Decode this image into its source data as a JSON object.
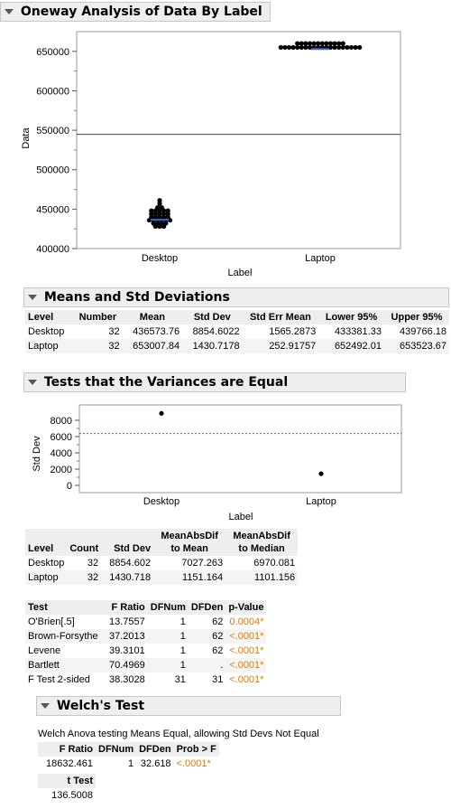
{
  "oneway": {
    "title": "Oneway Analysis of Data By Label",
    "ylabel": "Data",
    "xlabel": "Label",
    "yticks": [
      "650000",
      "600000",
      "550000",
      "500000",
      "450000",
      "400000"
    ],
    "categories": [
      "Desktop",
      "Laptop"
    ]
  },
  "chart_data": [
    {
      "type": "scatter",
      "title": "Oneway Analysis of Data By Label",
      "xlabel": "Label",
      "ylabel": "Data",
      "categories": [
        "Desktop",
        "Laptop"
      ],
      "ylim": [
        400000,
        675000
      ],
      "yticks": [
        400000,
        450000,
        500000,
        550000,
        600000,
        650000
      ],
      "grand_mean": 544790.8,
      "group_means": [
        436573.76,
        653007.84
      ],
      "desktop_points": [
        461000,
        457000,
        452000,
        452000,
        448000,
        448000,
        448000,
        448000,
        448000,
        444000,
        444000,
        444000,
        444000,
        444000,
        440000,
        440000,
        440000,
        440000,
        440000,
        436000,
        436000,
        436000,
        436000,
        436000,
        436000,
        432000,
        432000,
        432000,
        432000,
        428000,
        428000,
        428000
      ],
      "laptop_points": [
        660000,
        660000,
        660000,
        660000,
        660000,
        660000,
        660000,
        660000,
        660000,
        660000,
        660000,
        660000,
        655000,
        655000,
        655000,
        655000,
        655000,
        655000,
        655000,
        655000,
        655000,
        655000,
        655000,
        655000,
        655000,
        655000,
        655000,
        655000,
        655000,
        655000,
        655000,
        655000
      ]
    },
    {
      "type": "scatter",
      "title": "Tests that the Variances are Equal",
      "xlabel": "Label",
      "ylabel": "Std Dev",
      "categories": [
        "Desktop",
        "Laptop"
      ],
      "values": [
        8854.602,
        1430.718
      ],
      "ylim": [
        0,
        9000
      ],
      "yticks": [
        0,
        2000,
        4000,
        6000,
        8000
      ],
      "reference_line": 6380
    }
  ],
  "means": {
    "title": "Means and Std Deviations",
    "headers": [
      "Level",
      "Number",
      "Mean",
      "Std Dev",
      "Std Err Mean",
      "Lower 95%",
      "Upper 95%"
    ],
    "rows": [
      [
        "Desktop",
        "32",
        "436573.76",
        "8854.6022",
        "1565.2873",
        "433381.33",
        "439766.18"
      ],
      [
        "Laptop",
        "32",
        "653007.84",
        "1430.7178",
        "252.91757",
        "652492.01",
        "653523.67"
      ]
    ]
  },
  "variances": {
    "title": "Tests that the Variances are Equal",
    "ylabel": "Std Dev",
    "xlabel": "Label",
    "yticks": [
      "8000",
      "6000",
      "4000",
      "2000",
      "0"
    ],
    "categories": [
      "Desktop",
      "Laptop"
    ]
  },
  "stddev_table": {
    "headers": [
      "Level",
      "Count",
      "Std Dev",
      "MeanAbsDif to Mean",
      "MeanAbsDif to Median"
    ],
    "rows": [
      [
        "Desktop",
        "32",
        "8854.602",
        "7027.263",
        "6970.081"
      ],
      [
        "Laptop",
        "32",
        "1430.718",
        "1151.164",
        "1101.156"
      ]
    ]
  },
  "tests_table": {
    "headers": [
      "Test",
      "F Ratio",
      "DFNum",
      "DFDen",
      "p-Value"
    ],
    "rows": [
      [
        "O'Brien[.5]",
        "13.7557",
        "1",
        "62",
        "0.0004*"
      ],
      [
        "Brown-Forsythe",
        "37.2013",
        "1",
        "62",
        "<.0001*"
      ],
      [
        "Levene",
        "39.3101",
        "1",
        "62",
        "<.0001*"
      ],
      [
        "Bartlett",
        "70.4969",
        "1",
        ".",
        "<.0001*"
      ],
      [
        "F Test 2-sided",
        "38.3028",
        "31",
        "31",
        "<.0001*"
      ]
    ]
  },
  "welch": {
    "title": "Welch's Test",
    "subtitle": "Welch Anova testing Means Equal, allowing Std Devs Not Equal",
    "headers": [
      "F Ratio",
      "DFNum",
      "DFDen",
      "Prob > F"
    ],
    "row": [
      "18632.461",
      "1",
      "32.618",
      "<.0001*"
    ],
    "t_header": "t Test",
    "t_value": "136.5008"
  },
  "colors": {
    "header_bg": "#eeeeee",
    "mean_line": "#3b6bd6",
    "pvalue": "#e07a00"
  }
}
